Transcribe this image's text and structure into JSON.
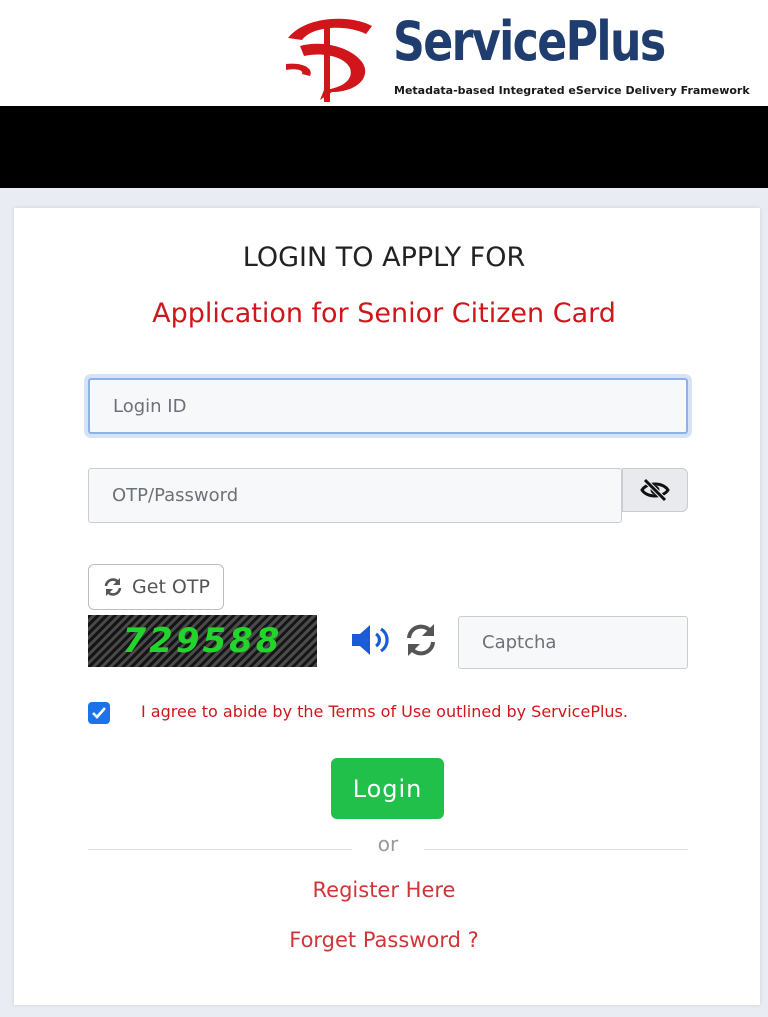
{
  "header": {
    "brand_name": "ServicePlus",
    "tagline": "Metadata-based Integrated eService Delivery Framework"
  },
  "login": {
    "title": "LOGIN TO APPLY FOR",
    "service_name": "Application for Senior Citizen Card",
    "login_id_placeholder": "Login ID",
    "password_placeholder": "OTP/Password",
    "get_otp_label": "Get OTP",
    "captcha_code": "729588",
    "captcha_placeholder": "Captcha",
    "terms_text": "I agree to abide by the Terms of Use outlined by ServicePlus.",
    "terms_checked": true,
    "login_button": "Login",
    "or_text": "or",
    "register_link": "Register Here",
    "forgot_link": "Forget Password ?"
  },
  "colors": {
    "brand_navy": "#1f3d6e",
    "accent_red": "#d0161b",
    "login_green": "#20c04a",
    "checkbox_blue": "#1a73e8",
    "captcha_green": "#22d42b"
  },
  "icons": [
    "servicepus-logo-icon",
    "eye-slash-icon",
    "refresh-icon",
    "audio-icon",
    "check-icon"
  ]
}
